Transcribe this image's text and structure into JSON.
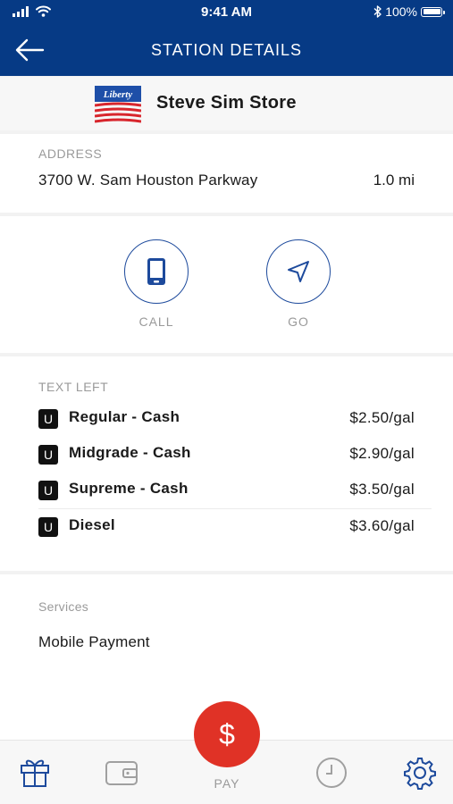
{
  "status_bar": {
    "time": "9:41 AM",
    "battery": "100%",
    "icons": [
      "signal-icon",
      "wifi-icon",
      "bluetooth-icon",
      "battery-icon"
    ]
  },
  "header": {
    "title": "STATION DETAILS",
    "back_icon": "back-arrow-icon",
    "background_color": "#063a85"
  },
  "store": {
    "name": "Steve Sim Store",
    "logo_text": "Liberty"
  },
  "address": {
    "label": "ADDRESS",
    "value": "3700 W. Sam Houston Parkway",
    "distance": "1.0 mi"
  },
  "actions": [
    {
      "label": "CALL",
      "icon": "phone-icon"
    },
    {
      "label": "GO",
      "icon": "navigation-icon"
    }
  ],
  "prices": {
    "label": "TEXT LEFT",
    "items": [
      {
        "badge": "U",
        "name": "Regular - Cash",
        "price": "$2.50/gal"
      },
      {
        "badge": "U",
        "name": "Midgrade - Cash",
        "price": "$2.90/gal"
      },
      {
        "badge": "U",
        "name": "Supreme - Cash",
        "price": "$3.50/gal"
      },
      {
        "badge": "U",
        "name": "Diesel",
        "price": "$3.60/gal"
      }
    ]
  },
  "services": {
    "label": "Services",
    "items": [
      "Mobile Payment"
    ]
  },
  "bottom_nav": {
    "pay_label": "PAY",
    "pay_symbol": "$",
    "pay_color": "#e03226",
    "icons": [
      "gift-icon",
      "wallet-icon",
      "dollar-icon",
      "clock-icon",
      "gear-icon"
    ],
    "accent_color": "#1d4a9c"
  }
}
